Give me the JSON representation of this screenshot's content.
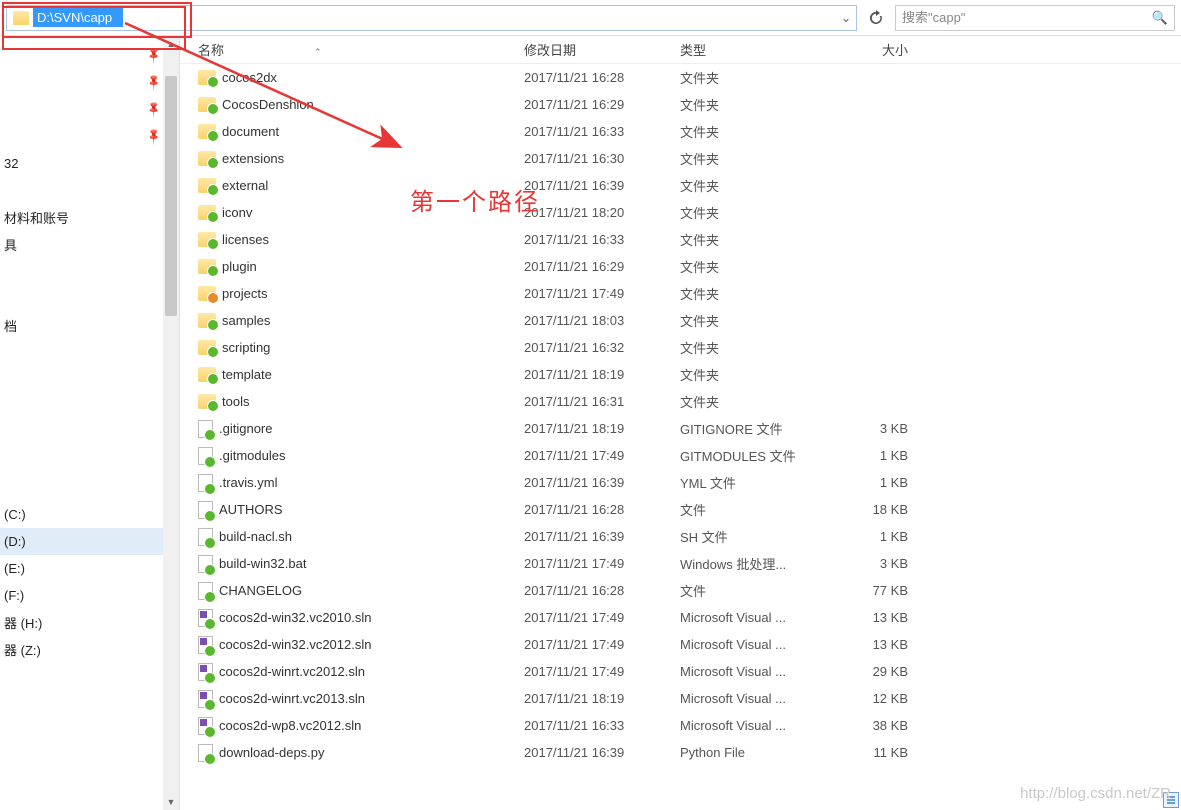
{
  "address": {
    "path": "D:\\SVN\\capp"
  },
  "search": {
    "placeholder": "搜索\"capp\""
  },
  "annotation": {
    "text": "第一个路径"
  },
  "watermark": "http://blog.csdn.net/ZR",
  "columns": {
    "name": "名称",
    "date": "修改日期",
    "type": "类型",
    "size": "大小"
  },
  "sidebar": {
    "items": [
      {
        "label": "",
        "pin": true
      },
      {
        "label": "",
        "pin": true
      },
      {
        "label": "",
        "pin": true
      },
      {
        "label": "",
        "pin": true
      },
      {
        "label": "32",
        "pin": false
      },
      {
        "label": "",
        "pin": false,
        "spacer": true
      },
      {
        "label": "材料和账号",
        "pin": false
      },
      {
        "label": "具",
        "pin": false
      },
      {
        "label": "",
        "pin": false,
        "spacer": true
      },
      {
        "label": "",
        "pin": false,
        "spacer": true
      },
      {
        "label": "档",
        "pin": false
      },
      {
        "label": "",
        "pin": false,
        "spacer": true
      },
      {
        "label": "",
        "pin": false,
        "spacer": true
      },
      {
        "label": "",
        "pin": false,
        "spacer": true
      },
      {
        "label": "",
        "pin": false,
        "spacer": true
      },
      {
        "label": "",
        "pin": false,
        "spacer": true
      },
      {
        "label": "",
        "pin": false,
        "spacer": true
      },
      {
        "label": " (C:)",
        "pin": false
      },
      {
        "label": " (D:)",
        "pin": false,
        "selected": true
      },
      {
        "label": " (E:)",
        "pin": false
      },
      {
        "label": " (F:)",
        "pin": false
      },
      {
        "label": "器 (H:)",
        "pin": false
      },
      {
        "label": "器 (Z:)",
        "pin": false
      }
    ]
  },
  "files": [
    {
      "name": "cocos2dx",
      "date": "2017/11/21 16:28",
      "type": "文件夹",
      "size": "",
      "icon": "folder-svn"
    },
    {
      "name": "CocosDenshion",
      "date": "2017/11/21 16:29",
      "type": "文件夹",
      "size": "",
      "icon": "folder-svn"
    },
    {
      "name": "document",
      "date": "2017/11/21 16:33",
      "type": "文件夹",
      "size": "",
      "icon": "folder-svn"
    },
    {
      "name": "extensions",
      "date": "2017/11/21 16:30",
      "type": "文件夹",
      "size": "",
      "icon": "folder-svn"
    },
    {
      "name": "external",
      "date": "2017/11/21 16:39",
      "type": "文件夹",
      "size": "",
      "icon": "folder-svn"
    },
    {
      "name": "iconv",
      "date": "2017/11/21 18:20",
      "type": "文件夹",
      "size": "",
      "icon": "folder-svn"
    },
    {
      "name": "licenses",
      "date": "2017/11/21 16:33",
      "type": "文件夹",
      "size": "",
      "icon": "folder-svn"
    },
    {
      "name": "plugin",
      "date": "2017/11/21 16:29",
      "type": "文件夹",
      "size": "",
      "icon": "folder-svn"
    },
    {
      "name": "projects",
      "date": "2017/11/21 17:49",
      "type": "文件夹",
      "size": "",
      "icon": "folder-warn"
    },
    {
      "name": "samples",
      "date": "2017/11/21 18:03",
      "type": "文件夹",
      "size": "",
      "icon": "folder-svn"
    },
    {
      "name": "scripting",
      "date": "2017/11/21 16:32",
      "type": "文件夹",
      "size": "",
      "icon": "folder-svn"
    },
    {
      "name": "template",
      "date": "2017/11/21 18:19",
      "type": "文件夹",
      "size": "",
      "icon": "folder-svn"
    },
    {
      "name": "tools",
      "date": "2017/11/21 16:31",
      "type": "文件夹",
      "size": "",
      "icon": "folder-svn"
    },
    {
      "name": ".gitignore",
      "date": "2017/11/21 18:19",
      "type": "GITIGNORE 文件",
      "size": "3 KB",
      "icon": "file-svn"
    },
    {
      "name": ".gitmodules",
      "date": "2017/11/21 17:49",
      "type": "GITMODULES 文件",
      "size": "1 KB",
      "icon": "file-svn"
    },
    {
      "name": ".travis.yml",
      "date": "2017/11/21 16:39",
      "type": "YML 文件",
      "size": "1 KB",
      "icon": "file-svn"
    },
    {
      "name": "AUTHORS",
      "date": "2017/11/21 16:28",
      "type": "文件",
      "size": "18 KB",
      "icon": "file-svn"
    },
    {
      "name": "build-nacl.sh",
      "date": "2017/11/21 16:39",
      "type": "SH 文件",
      "size": "1 KB",
      "icon": "file-svn"
    },
    {
      "name": "build-win32.bat",
      "date": "2017/11/21 17:49",
      "type": "Windows 批处理...",
      "size": "3 KB",
      "icon": "file-svn"
    },
    {
      "name": "CHANGELOG",
      "date": "2017/11/21 16:28",
      "type": "文件",
      "size": "77 KB",
      "icon": "file-svn"
    },
    {
      "name": "cocos2d-win32.vc2010.sln",
      "date": "2017/11/21 17:49",
      "type": "Microsoft Visual ...",
      "size": "13 KB",
      "icon": "sln"
    },
    {
      "name": "cocos2d-win32.vc2012.sln",
      "date": "2017/11/21 17:49",
      "type": "Microsoft Visual ...",
      "size": "13 KB",
      "icon": "sln"
    },
    {
      "name": "cocos2d-winrt.vc2012.sln",
      "date": "2017/11/21 17:49",
      "type": "Microsoft Visual ...",
      "size": "29 KB",
      "icon": "sln"
    },
    {
      "name": "cocos2d-winrt.vc2013.sln",
      "date": "2017/11/21 18:19",
      "type": "Microsoft Visual ...",
      "size": "12 KB",
      "icon": "sln"
    },
    {
      "name": "cocos2d-wp8.vc2012.sln",
      "date": "2017/11/21 16:33",
      "type": "Microsoft Visual ...",
      "size": "38 KB",
      "icon": "sln"
    },
    {
      "name": "download-deps.py",
      "date": "2017/11/21 16:39",
      "type": "Python File",
      "size": "11 KB",
      "icon": "file-svn"
    }
  ]
}
